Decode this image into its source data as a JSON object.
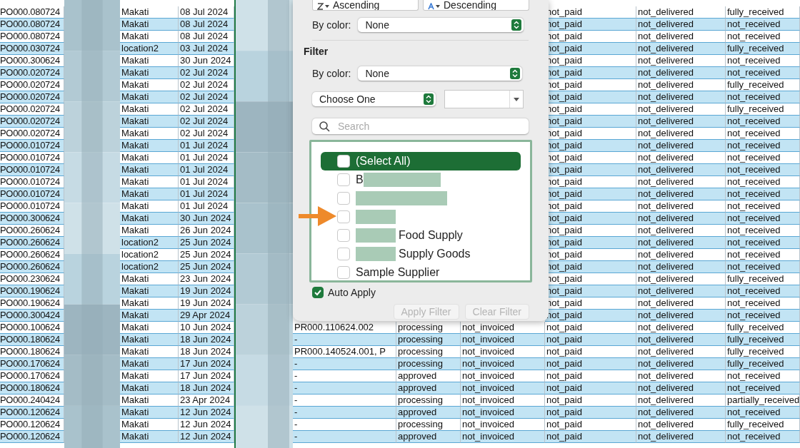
{
  "sheet": {
    "rows": [
      {
        "po_number": "PO000.080724",
        "location": "Makati",
        "date": "08 Jul 2024",
        "payment_status": "not_paid",
        "delivery_status": "not_delivered",
        "receipt_status": "fully_received"
      },
      {
        "po_number": "PO000.080724",
        "location": "Makati",
        "date": "08 Jul 2024",
        "payment_status": "not_paid",
        "delivery_status": "not_delivered",
        "receipt_status": "not_received"
      },
      {
        "po_number": "PO000.080724",
        "location": "Makati",
        "date": "08 Jul 2024",
        "payment_status": "not_paid",
        "delivery_status": "not_delivered",
        "receipt_status": "not_received"
      },
      {
        "po_number": "PO000.030724",
        "location": "location2",
        "date": "03 Jul 2024",
        "payment_status": "not_paid",
        "delivery_status": "not_delivered",
        "receipt_status": "fully_received"
      },
      {
        "po_number": "PO000.300624",
        "location": "Makati",
        "date": "30 Jun 2024",
        "payment_status": "not_paid",
        "delivery_status": "not_delivered",
        "receipt_status": "not_received"
      },
      {
        "po_number": "PO000.020724",
        "location": "Makati",
        "date": "02 Jul 2024",
        "payment_status": "not_paid",
        "delivery_status": "not_delivered",
        "receipt_status": "not_received"
      },
      {
        "po_number": "PO000.020724",
        "location": "Makati",
        "date": "02 Jul 2024",
        "payment_status": "not_paid",
        "delivery_status": "not_delivered",
        "receipt_status": "fully_received"
      },
      {
        "po_number": "PO000.020724",
        "location": "Makati",
        "date": "02 Jul 2024",
        "payment_status": "not_paid",
        "delivery_status": "not_delivered",
        "receipt_status": "not_received"
      },
      {
        "po_number": "PO000.020724",
        "location": "Makati",
        "date": "02 Jul 2024",
        "payment_status": "not_paid",
        "delivery_status": "not_delivered",
        "receipt_status": "fully_received"
      },
      {
        "po_number": "PO000.020724",
        "location": "Makati",
        "date": "02 Jul 2024",
        "payment_status": "not_paid",
        "delivery_status": "not_delivered",
        "receipt_status": "not_received"
      },
      {
        "po_number": "PO000.020724",
        "location": "Makati",
        "date": "02 Jul 2024",
        "payment_status": "not_paid",
        "delivery_status": "not_delivered",
        "receipt_status": "not_received"
      },
      {
        "po_number": "PO000.010724",
        "location": "Makati",
        "date": "01 Jul 2024",
        "payment_status": "not_paid",
        "delivery_status": "not_delivered",
        "receipt_status": "not_received"
      },
      {
        "po_number": "PO000.010724",
        "location": "Makati",
        "date": "01 Jul 2024",
        "payment_status": "not_paid",
        "delivery_status": "not_delivered",
        "receipt_status": "not_received"
      },
      {
        "po_number": "PO000.010724",
        "location": "Makati",
        "date": "01 Jul 2024",
        "payment_status": "not_paid",
        "delivery_status": "not_delivered",
        "receipt_status": "not_received"
      },
      {
        "po_number": "PO000.010724",
        "location": "Makati",
        "date": "01 Jul 2024",
        "payment_status": "not_paid",
        "delivery_status": "not_delivered",
        "receipt_status": "not_received"
      },
      {
        "po_number": "PO000.010724",
        "location": "Makati",
        "date": "01 Jul 2024",
        "payment_status": "not_paid",
        "delivery_status": "not_delivered",
        "receipt_status": "not_received"
      },
      {
        "po_number": "PO000.010724",
        "location": "Makati",
        "date": "01 Jul 2024",
        "payment_status": "not_paid",
        "delivery_status": "not_delivered",
        "receipt_status": "not_received"
      },
      {
        "po_number": "PO000.300624",
        "location": "Makati",
        "date": "30 Jun 2024",
        "payment_status": "not_paid",
        "delivery_status": "not_delivered",
        "receipt_status": "not_received"
      },
      {
        "po_number": "PO000.260624",
        "location": "Makati",
        "date": "26 Jun 2024",
        "payment_status": "not_paid",
        "delivery_status": "not_delivered",
        "receipt_status": "not_received"
      },
      {
        "po_number": "PO000.260624",
        "location": "location2",
        "date": "25 Jun 2024",
        "payment_status": "not_paid",
        "delivery_status": "not_delivered",
        "receipt_status": "not_received"
      },
      {
        "po_number": "PO000.260624",
        "location": "location2",
        "date": "25 Jun 2024",
        "payment_status": "not_paid",
        "delivery_status": "not_delivered",
        "receipt_status": "not_received"
      },
      {
        "po_number": "PO000.260624",
        "location": "location2",
        "date": "25 Jun 2024",
        "payment_status": "not_paid",
        "delivery_status": "not_delivered",
        "receipt_status": "not_received"
      },
      {
        "po_number": "PO000.230624",
        "location": "Makati",
        "date": "23 Jun 2024",
        "payment_status": "not_paid",
        "delivery_status": "not_delivered",
        "receipt_status": "fully_received"
      },
      {
        "po_number": "PO000.190624",
        "location": "Makati",
        "date": "19 Jun 2024",
        "payment_status": "not_paid",
        "delivery_status": "not_delivered",
        "receipt_status": "not_received"
      },
      {
        "po_number": "PO000.190624",
        "location": "Makati",
        "date": "19 Jun 2024",
        "payment_status": "not_paid",
        "delivery_status": "not_delivered",
        "receipt_status": "not_received"
      },
      {
        "po_number": "PO000.300424",
        "location": "Makati",
        "date": "29 Apr 2024",
        "payment_status": "not_paid",
        "delivery_status": "not_delivered",
        "receipt_status": "not_received"
      },
      {
        "po_number": "PO000.100624",
        "location": "Makati",
        "date": "10 Jun 2024",
        "pr_reference": "PR000.110624.002",
        "status": "processing",
        "invoice_status": "not_invoiced",
        "payment_status": "not_paid",
        "delivery_status": "not_delivered",
        "receipt_status": "fully_received"
      },
      {
        "po_number": "PO000.180624",
        "location": "Makati",
        "date": "18 Jun 2024",
        "pr_reference": "-",
        "status": "processing",
        "invoice_status": "not_invoiced",
        "payment_status": "not_paid",
        "delivery_status": "not_delivered",
        "receipt_status": "fully_received"
      },
      {
        "po_number": "PO000.180624",
        "location": "Makati",
        "date": "18 Jun 2024",
        "pr_reference": "PR000.140524.001, P",
        "status": "processing",
        "invoice_status": "not_invoiced",
        "payment_status": "not_paid",
        "delivery_status": "not_delivered",
        "receipt_status": "fully_received"
      },
      {
        "po_number": "PO000.170624",
        "location": "Makati",
        "date": "17 Jun 2024",
        "pr_reference": "-",
        "status": "processing",
        "invoice_status": "not_invoiced",
        "payment_status": "not_paid",
        "delivery_status": "not_delivered",
        "receipt_status": "fully_received"
      },
      {
        "po_number": "PO000.170624",
        "location": "Makati",
        "date": "17 Jun 2024",
        "pr_reference": "-",
        "status": "approved",
        "invoice_status": "not_invoiced",
        "payment_status": "not_paid",
        "delivery_status": "not_delivered",
        "receipt_status": "not_received"
      },
      {
        "po_number": "PO000.180624",
        "location": "Makati",
        "date": "18 Jun 2024",
        "pr_reference": "-",
        "status": "approved",
        "invoice_status": "not_invoiced",
        "payment_status": "not_paid",
        "delivery_status": "not_delivered",
        "receipt_status": "not_received"
      },
      {
        "po_number": "PO000.240424",
        "location": "Makati",
        "date": "23 Apr 2024",
        "pr_reference": "-",
        "status": "processing",
        "invoice_status": "not_invoiced",
        "payment_status": "not_paid",
        "delivery_status": "not_delivered",
        "receipt_status": "partially_received"
      },
      {
        "po_number": "PO000.120624",
        "location": "Makati",
        "date": "12 Jun 2024",
        "pr_reference": "-",
        "status": "approved",
        "invoice_status": "not_invoiced",
        "payment_status": "not_paid",
        "delivery_status": "not_delivered",
        "receipt_status": "not_received"
      },
      {
        "po_number": "PO000.120624",
        "location": "Makati",
        "date": "12 Jun 2024",
        "pr_reference": "-",
        "status": "processing",
        "invoice_status": "not_invoiced",
        "payment_status": "not_paid",
        "delivery_status": "not_delivered",
        "receipt_status": "fully_received"
      },
      {
        "po_number": "PO000.120624",
        "location": "Makati",
        "date": "12 Jun 2024",
        "pr_reference": "-",
        "status": "approved",
        "invoice_status": "not_invoiced",
        "payment_status": "not_paid",
        "delivery_status": "not_delivered",
        "receipt_status": "not_received"
      }
    ]
  },
  "filter_popup": {
    "sort_buttons": [
      {
        "kind": "ascending",
        "label": "Ascending"
      },
      {
        "kind": "descending",
        "label": "Descending"
      }
    ],
    "sort_by_color": {
      "label": "By color:",
      "value": "None"
    },
    "filter_title": "Filter",
    "filter_by_color": {
      "label": "By color:",
      "value": "None"
    },
    "condition": {
      "value": "Choose One"
    },
    "search": {
      "placeholder": "Search"
    },
    "items": [
      {
        "label": "(Select All)",
        "checked": false,
        "selected": true
      },
      {
        "prefix": "B",
        "kind": "wide",
        "checked": false,
        "selected": false
      },
      {
        "kind": "wider",
        "checked": false,
        "selected": false
      },
      {
        "kind": "narrow",
        "checked": false,
        "selected": false
      },
      {
        "kind": "narrow",
        "label": "Food Supply",
        "checked": false,
        "selected": false
      },
      {
        "kind": "narrow",
        "label": "Supply Goods",
        "checked": false,
        "selected": false
      },
      {
        "label": "Sample Supplier",
        "checked": false,
        "selected": false
      }
    ],
    "auto_apply": {
      "label": "Auto Apply",
      "checked": true
    },
    "buttons": [
      {
        "label": "Apply Filter",
        "disabled": true
      },
      {
        "label": "Clear Filter",
        "disabled": true
      }
    ]
  }
}
